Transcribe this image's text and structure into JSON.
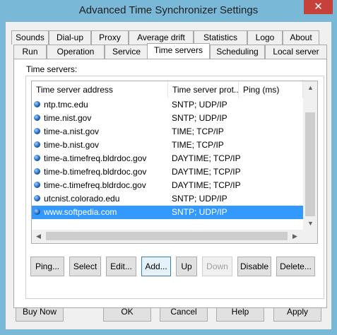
{
  "window": {
    "title": "Advanced Time Synchronizer Settings",
    "close_glyph": "✕"
  },
  "tabs_row1": [
    "Sounds",
    "Dial-up",
    "Proxy",
    "Average drift",
    "Statistics",
    "Logo",
    "About"
  ],
  "tabs_row2": [
    "Run",
    "Operation",
    "Service",
    "Time servers",
    "Scheduling",
    "Local server"
  ],
  "active_tab": "Time servers",
  "group": {
    "label": "Time servers:"
  },
  "list": {
    "columns": [
      "Time server address",
      "Time server prot...",
      "Ping (ms)"
    ],
    "rows": [
      {
        "address": "ntp.tmc.edu",
        "protocol": "SNTP; UDP/IP"
      },
      {
        "address": "time.nist.gov",
        "protocol": "SNTP; UDP/IP"
      },
      {
        "address": "time-a.nist.gov",
        "protocol": "TIME; TCP/IP"
      },
      {
        "address": "time-b.nist.gov",
        "protocol": "TIME; TCP/IP"
      },
      {
        "address": "time-a.timefreq.bldrdoc.gov",
        "protocol": "DAYTIME; TCP/IP"
      },
      {
        "address": "time-b.timefreq.bldrdoc.gov",
        "protocol": "DAYTIME; TCP/IP"
      },
      {
        "address": "time-c.timefreq.bldrdoc.gov",
        "protocol": "DAYTIME; TCP/IP"
      },
      {
        "address": "utcnist.colorado.edu",
        "protocol": "SNTP; UDP/IP"
      },
      {
        "address": "www.softpedia.com",
        "protocol": "SNTP; UDP/IP"
      }
    ],
    "selected_index": 8
  },
  "list_buttons": {
    "ping": "Ping...",
    "select": "Select",
    "edit": "Edit...",
    "add": "Add...",
    "up": "Up",
    "down": "Down",
    "disable": "Disable",
    "delete": "Delete..."
  },
  "footer_buttons": {
    "buy_now": "Buy Now",
    "ok": "OK",
    "cancel": "Cancel",
    "help": "Help",
    "apply": "Apply"
  },
  "colors": {
    "frame": "#79b9d7",
    "close": "#c7413b",
    "selection": "#3399ff"
  }
}
